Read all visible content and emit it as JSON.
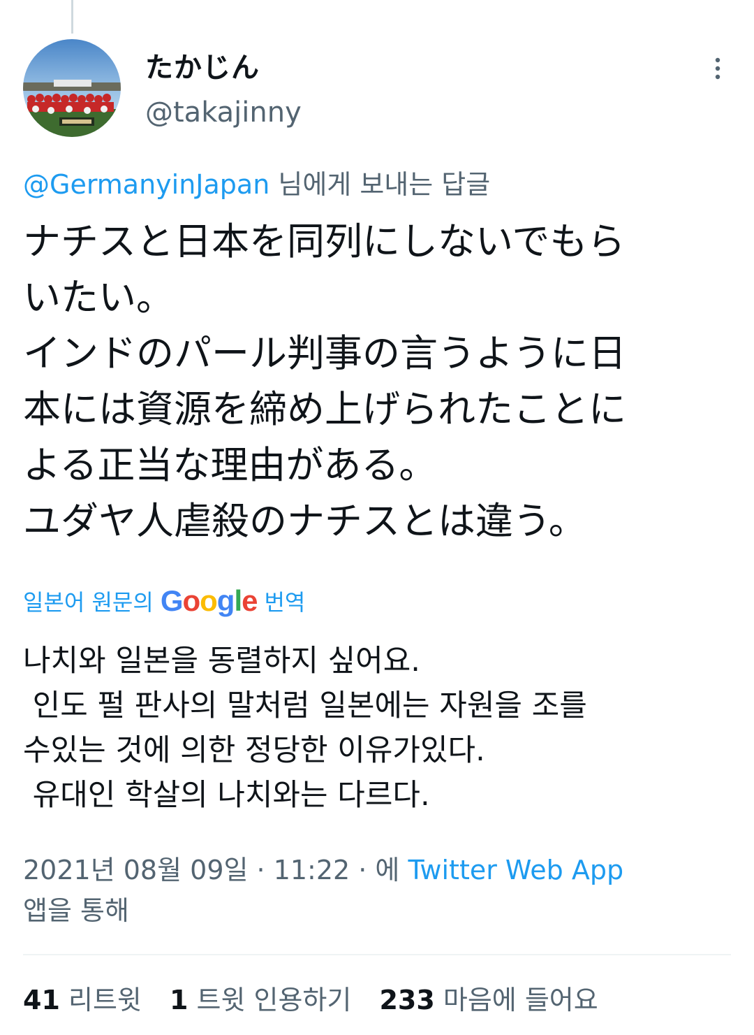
{
  "tweet": {
    "display_name": "たかじん",
    "handle": "@takajinny",
    "reply_to_mention": "@GermanyinJapan",
    "reply_to_suffix": " 님에게 보내는 답글",
    "body_lines": [
      "ナチスと日本を同列にしないでもら",
      "いたい。",
      "インドのパール判事の言うように日",
      "本には資源を締め上げられたことに",
      "よる正当な理由がある。",
      "ユダヤ人虐殺のナチスとは違う。"
    ],
    "translate": {
      "prefix": "일본어 원문의",
      "brand": "Google",
      "suffix": "번역"
    },
    "translation_lines": [
      "나치와 일본을 동렬하지 싶어요.",
      " 인도 펄 판사의 말처럼 일본에는 자원을 조를",
      "수있는 것에 의한 정당한 이유가있다.",
      " 유대인 학살의 나치와는 다르다."
    ],
    "meta": {
      "datetime": "2021년 08월 09일 · 11:22 · 에 ",
      "source": "Twitter Web App",
      "suffix": "앱을 통해"
    },
    "stats": {
      "retweets_count": "41",
      "retweets_label": "리트윗",
      "quotes_count": "1",
      "quotes_label": "트윗 인용하기",
      "likes_count": "233",
      "likes_label": "마음에 들어요"
    }
  },
  "colors": {
    "primary_text": "#0f1419",
    "secondary_text": "#536471",
    "link": "#1d9bf0",
    "divider": "#eff3f4"
  },
  "icons": {
    "more": "more-vertical-icon"
  }
}
